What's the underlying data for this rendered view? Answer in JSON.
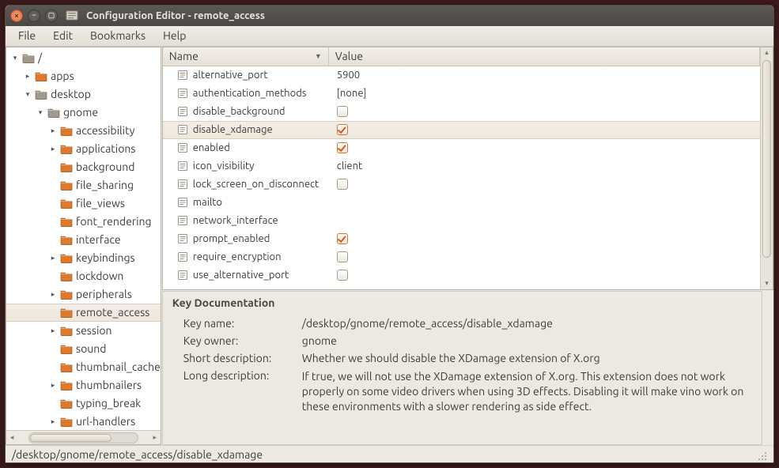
{
  "window": {
    "title": "Configuration Editor - remote_access"
  },
  "menubar": [
    "File",
    "Edit",
    "Bookmarks",
    "Help"
  ],
  "tree": [
    {
      "depth": 0,
      "label": "/",
      "expandable": true,
      "open": true,
      "iconColor": "#9e9b95",
      "selected": false
    },
    {
      "depth": 1,
      "label": "apps",
      "expandable": true,
      "open": false,
      "iconColor": "#e07a2a",
      "selected": false
    },
    {
      "depth": 1,
      "label": "desktop",
      "expandable": true,
      "open": true,
      "iconColor": "#9e9b95",
      "selected": false
    },
    {
      "depth": 2,
      "label": "gnome",
      "expandable": true,
      "open": true,
      "iconColor": "#9e9b95",
      "selected": false
    },
    {
      "depth": 3,
      "label": "accessibility",
      "expandable": true,
      "open": false,
      "iconColor": "#e07a2a",
      "selected": false
    },
    {
      "depth": 3,
      "label": "applications",
      "expandable": true,
      "open": false,
      "iconColor": "#e07a2a",
      "selected": false
    },
    {
      "depth": 3,
      "label": "background",
      "expandable": false,
      "open": false,
      "iconColor": "#e07a2a",
      "selected": false
    },
    {
      "depth": 3,
      "label": "file_sharing",
      "expandable": false,
      "open": false,
      "iconColor": "#e07a2a",
      "selected": false
    },
    {
      "depth": 3,
      "label": "file_views",
      "expandable": false,
      "open": false,
      "iconColor": "#e07a2a",
      "selected": false
    },
    {
      "depth": 3,
      "label": "font_rendering",
      "expandable": false,
      "open": false,
      "iconColor": "#e07a2a",
      "selected": false
    },
    {
      "depth": 3,
      "label": "interface",
      "expandable": false,
      "open": false,
      "iconColor": "#e07a2a",
      "selected": false
    },
    {
      "depth": 3,
      "label": "keybindings",
      "expandable": true,
      "open": false,
      "iconColor": "#e07a2a",
      "selected": false
    },
    {
      "depth": 3,
      "label": "lockdown",
      "expandable": false,
      "open": false,
      "iconColor": "#e07a2a",
      "selected": false
    },
    {
      "depth": 3,
      "label": "peripherals",
      "expandable": true,
      "open": false,
      "iconColor": "#e07a2a",
      "selected": false
    },
    {
      "depth": 3,
      "label": "remote_access",
      "expandable": false,
      "open": false,
      "iconColor": "#e07a2a",
      "selected": true
    },
    {
      "depth": 3,
      "label": "session",
      "expandable": true,
      "open": false,
      "iconColor": "#e07a2a",
      "selected": false
    },
    {
      "depth": 3,
      "label": "sound",
      "expandable": false,
      "open": false,
      "iconColor": "#e07a2a",
      "selected": false
    },
    {
      "depth": 3,
      "label": "thumbnail_cache",
      "expandable": false,
      "open": false,
      "iconColor": "#e07a2a",
      "selected": false
    },
    {
      "depth": 3,
      "label": "thumbnailers",
      "expandable": true,
      "open": false,
      "iconColor": "#e07a2a",
      "selected": false
    },
    {
      "depth": 3,
      "label": "typing_break",
      "expandable": false,
      "open": false,
      "iconColor": "#e07a2a",
      "selected": false
    },
    {
      "depth": 3,
      "label": "url-handlers",
      "expandable": true,
      "open": false,
      "iconColor": "#e07a2a",
      "selected": false
    }
  ],
  "list": {
    "columns": {
      "name": "Name",
      "value": "Value"
    },
    "rows": [
      {
        "name": "alternative_port",
        "type": "number",
        "value": "5900",
        "selected": false
      },
      {
        "name": "authentication_methods",
        "type": "list",
        "value": "[none]",
        "selected": false
      },
      {
        "name": "disable_background",
        "type": "bool",
        "checked": false,
        "selected": false
      },
      {
        "name": "disable_xdamage",
        "type": "bool",
        "checked": true,
        "selected": true
      },
      {
        "name": "enabled",
        "type": "bool",
        "checked": true,
        "selected": false
      },
      {
        "name": "icon_visibility",
        "type": "string",
        "value": "client",
        "selected": false
      },
      {
        "name": "lock_screen_on_disconnect",
        "type": "bool",
        "checked": false,
        "selected": false
      },
      {
        "name": "mailto",
        "type": "string",
        "value": "",
        "selected": false
      },
      {
        "name": "network_interface",
        "type": "string",
        "value": "",
        "selected": false
      },
      {
        "name": "prompt_enabled",
        "type": "bool",
        "checked": true,
        "selected": false
      },
      {
        "name": "require_encryption",
        "type": "bool",
        "checked": false,
        "selected": false
      },
      {
        "name": "use_alternative_port",
        "type": "bool",
        "checked": false,
        "selected": false
      }
    ]
  },
  "doc": {
    "heading": "Key Documentation",
    "labels": {
      "name": "Key name:",
      "owner": "Key owner:",
      "short": "Short description:",
      "long": "Long description:"
    },
    "key_name": "/desktop/gnome/remote_access/disable_xdamage",
    "key_owner": "gnome",
    "short_desc": "Whether we should disable the XDamage extension of X.org",
    "long_desc": "If true, we will not use the XDamage extension of X.org. This extension does not work properly on some video drivers when using 3D effects. Disabling it will make vino work on these environments with a slower rendering as side effect."
  },
  "statusbar": "/desktop/gnome/remote_access/disable_xdamage"
}
